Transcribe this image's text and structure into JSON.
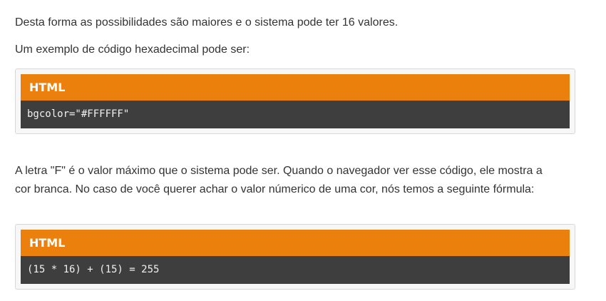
{
  "paragraphs": {
    "intro": "Desta forma as possibilidades são maiores e o sistema pode ter 16 valores.",
    "example_intro": "Um exemplo de código hexadecimal pode ser:",
    "explanation": "A letra \"F\" é o valor máximo que o sistema pode ser. Quando o navegador ver esse código, ele mostra a cor branca. No caso de você querer achar o valor númerico de uma cor, nós temos a seguinte fórmula:"
  },
  "code_blocks": [
    {
      "language": "HTML",
      "code": "bgcolor=\"#FFFFFF\""
    },
    {
      "language": "HTML",
      "code": "(15 * 16) + (15) = 255"
    }
  ],
  "colors": {
    "header_accent": "#ec800d",
    "code_background": "#3e3e3e",
    "code_text": "#f0f0f0"
  }
}
